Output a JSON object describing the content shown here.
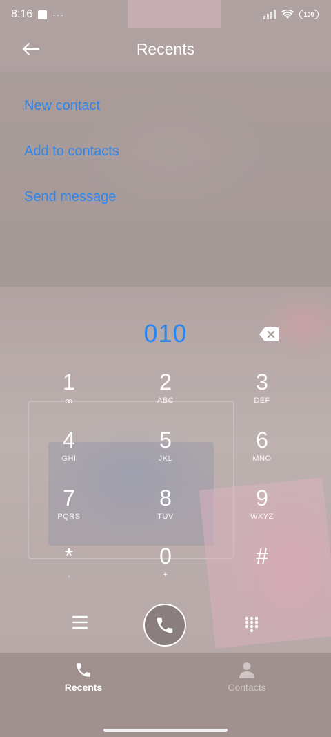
{
  "status_bar": {
    "time": "8:16",
    "more_indicator": "···",
    "battery": "100"
  },
  "header": {
    "title": "Recents",
    "back_icon": "arrow-left-icon"
  },
  "options": [
    {
      "label": "New contact"
    },
    {
      "label": "Add to contacts"
    },
    {
      "label": "Send message"
    }
  ],
  "dialer": {
    "number": "010",
    "backspace_icon": "backspace-icon",
    "keys": [
      {
        "digit": "1",
        "letters": "ꝏ"
      },
      {
        "digit": "2",
        "letters": "ABC"
      },
      {
        "digit": "3",
        "letters": "DEF"
      },
      {
        "digit": "4",
        "letters": "GHI"
      },
      {
        "digit": "5",
        "letters": "JKL"
      },
      {
        "digit": "6",
        "letters": "MNO"
      },
      {
        "digit": "7",
        "letters": "PQRS"
      },
      {
        "digit": "8",
        "letters": "TUV"
      },
      {
        "digit": "9",
        "letters": "WXYZ"
      },
      {
        "digit": "*",
        "letters": ","
      },
      {
        "digit": "0",
        "letters": "+"
      },
      {
        "digit": "#",
        "letters": ""
      }
    ]
  },
  "actions": {
    "menu_icon": "menu-icon",
    "call_icon": "phone-icon",
    "dialpad_icon": "dialpad-icon"
  },
  "bottom_nav": {
    "recents": {
      "label": "Recents",
      "icon": "phone-icon"
    },
    "contacts": {
      "label": "Contacts",
      "icon": "person-icon"
    }
  },
  "colors": {
    "accent": "#2b86ef",
    "nav_background": "#a0908e"
  }
}
